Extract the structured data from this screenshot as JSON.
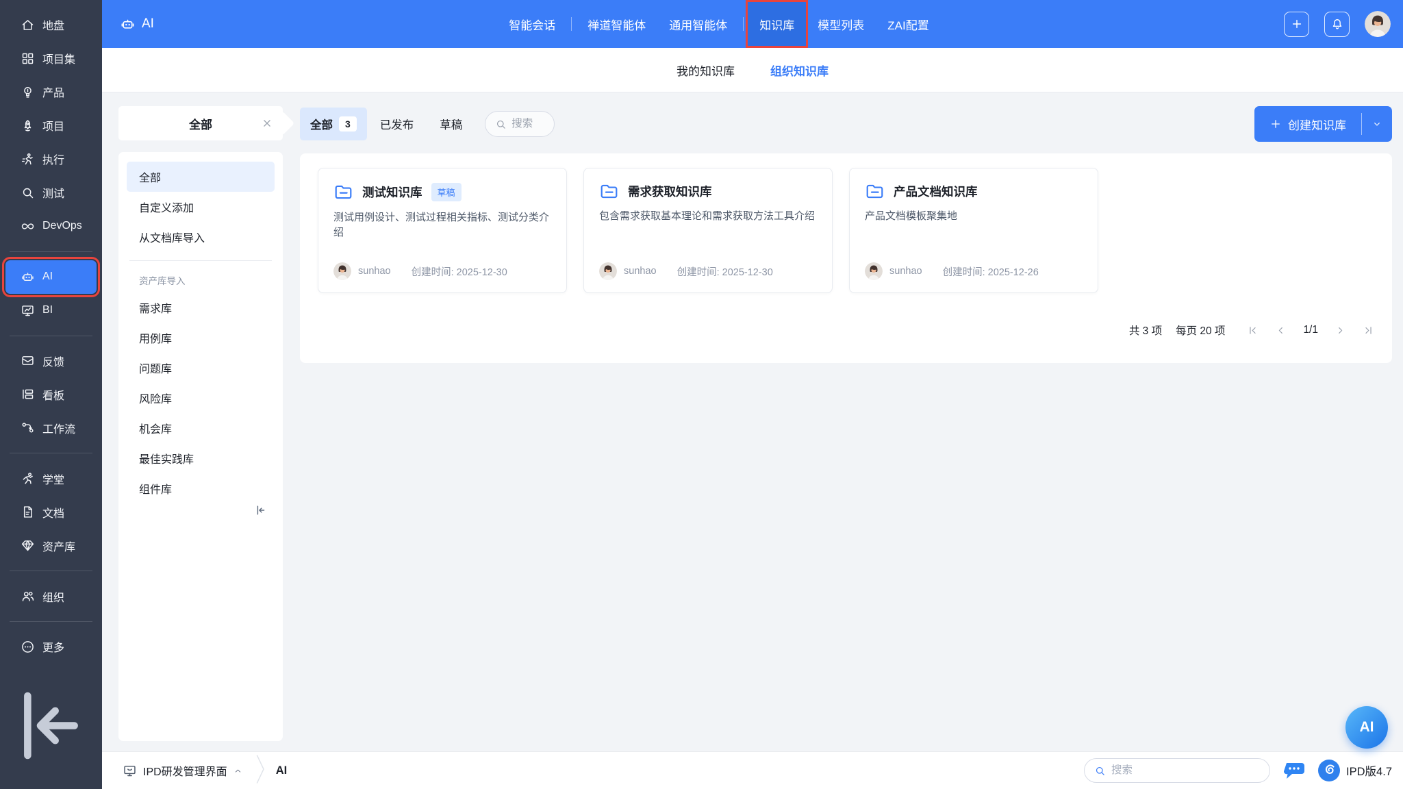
{
  "colors": {
    "topbar_blue": "#3b7df8",
    "topbar_active_blue": "#2d6ee2",
    "sidebar_bg": "#343c4d",
    "annotation_red": "#e8443d",
    "page_bg": "#f2f4f7",
    "active_filter_tab_bg": "#dbe8fd",
    "badge_bg": "#dfecfe",
    "accent_blue": "#3b7df8"
  },
  "sidebar": {
    "items": [
      {
        "label": "地盘",
        "icon": "home-icon"
      },
      {
        "label": "项目集",
        "icon": "program-grid-icon"
      },
      {
        "label": "产品",
        "icon": "product-bulb-icon"
      },
      {
        "label": "项目",
        "icon": "project-rocket-icon"
      },
      {
        "label": "执行",
        "icon": "execution-runner-icon"
      },
      {
        "label": "测试",
        "icon": "qa-search-icon"
      },
      {
        "label": "DevOps",
        "icon": "devops-infinity-icon"
      },
      {
        "label": "AI",
        "icon": "ai-robot-icon",
        "active": true,
        "annotated": true
      },
      {
        "label": "BI",
        "icon": "bi-chart-icon"
      },
      {
        "label": "反馈",
        "icon": "feedback-mail-icon"
      },
      {
        "label": "看板",
        "icon": "kanban-board-icon"
      },
      {
        "label": "工作流",
        "icon": "workflow-icon"
      },
      {
        "label": "学堂",
        "icon": "school-icon"
      },
      {
        "label": "文档",
        "icon": "document-icon"
      },
      {
        "label": "资产库",
        "icon": "asset-gem-icon"
      },
      {
        "label": "组织",
        "icon": "org-users-icon"
      },
      {
        "label": "更多",
        "icon": "more-ellipsis-icon"
      }
    ]
  },
  "topbar": {
    "app_label": "AI",
    "nav": [
      {
        "label": "智能会话"
      },
      {
        "label": "禅道智能体"
      },
      {
        "label": "通用智能体"
      },
      {
        "label": "知识库",
        "active": true,
        "annotated": true
      },
      {
        "label": "模型列表"
      },
      {
        "label": "ZAI配置"
      }
    ]
  },
  "subtabs": {
    "my": "我的知识库",
    "org": "组织知识库"
  },
  "filter_tag": {
    "label": "全部",
    "close_icon": "close-icon"
  },
  "left_panel": {
    "items_top": [
      "全部",
      "自定义添加",
      "从文档库导入"
    ],
    "active_item": "全部",
    "section_label": "资产库导入",
    "items_assets": [
      "需求库",
      "用例库",
      "问题库",
      "风险库",
      "机会库",
      "最佳实践库",
      "组件库"
    ]
  },
  "toolbar": {
    "tab_all": "全部",
    "tab_all_count": "3",
    "tab_published": "已发布",
    "tab_draft": "草稿",
    "search_placeholder": "搜索",
    "create_label": "创建知识库"
  },
  "cards": [
    {
      "title": "测试知识库",
      "badge": "草稿",
      "description": "测试用例设计、测试过程相关指标、测试分类介绍",
      "owner": "sunhao",
      "created": "创建时间: 2025-12-30"
    },
    {
      "title": "需求获取知识库",
      "description": "包含需求获取基本理论和需求获取方法工具介绍",
      "owner": "sunhao",
      "created": "创建时间: 2025-12-30"
    },
    {
      "title": "产品文档知识库",
      "description": "产品文档模板聚集地",
      "owner": "sunhao",
      "created": "创建时间: 2025-12-26"
    }
  ],
  "pagination": {
    "total": "共 3 项",
    "per_page": "每页 20 项",
    "page": "1/1"
  },
  "bottom_bar": {
    "app_switcher": "IPD研发管理界面",
    "current": "AI",
    "search_placeholder": "搜索",
    "version": "IPD版4.7"
  },
  "floating_ai_label": "AI"
}
